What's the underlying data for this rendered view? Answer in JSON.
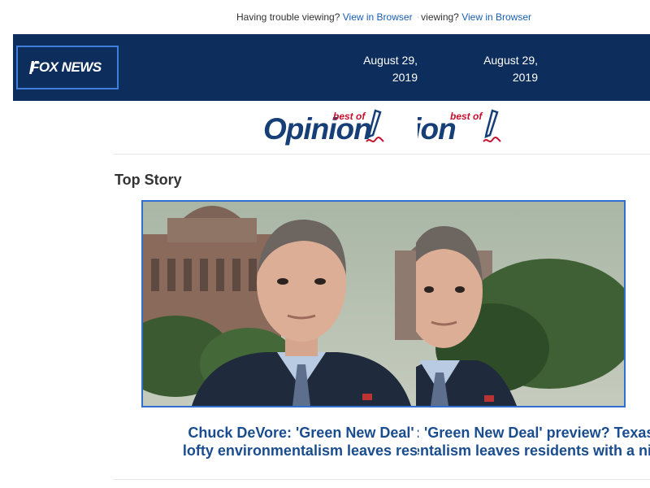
{
  "preheader": {
    "text": "Having trouble viewing?",
    "link_label": "View in Browser"
  },
  "brand": {
    "logo_text": "FOX NEWS",
    "header_color": "#0d2d5c"
  },
  "date": {
    "line1": "August 29,",
    "line2": "2019"
  },
  "opinion_logo": {
    "word": "Opinion",
    "tag": "best of"
  },
  "section": {
    "title": "Top Story"
  },
  "top_story": {
    "headline_line1": "Chuck DeVore: 'Green New Deal' preview? Texas town's",
    "headline_line2": "lofty environmentalism leaves residents with a nightmare"
  },
  "colors": {
    "link": "#1a5fb4",
    "headline": "#1a4d8f",
    "opinion_blue": "#163e77",
    "opinion_red": "#c8102e",
    "photo_border": "#2f6fd1"
  }
}
